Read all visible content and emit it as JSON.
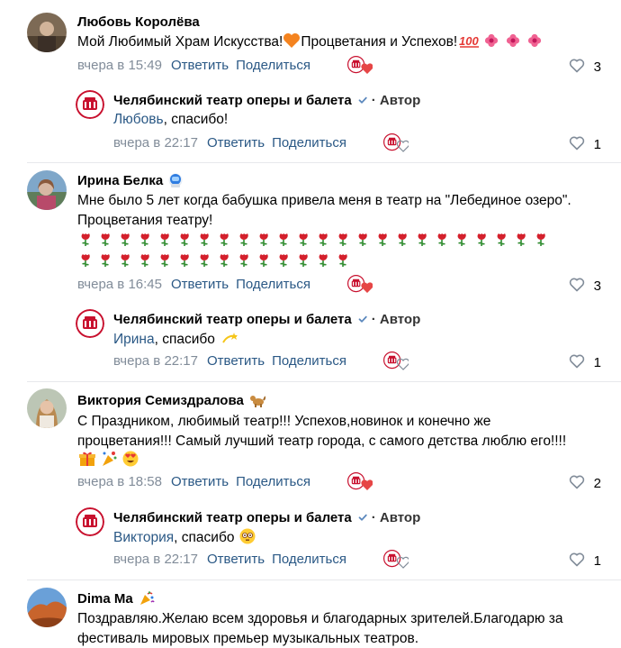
{
  "actions": {
    "reply": "Ответить",
    "share": "Поделиться"
  },
  "comments": [
    {
      "author": "Любовь Королёва",
      "text": "Мой Любимый Храм Искусства!",
      "text2": "Процветания и Успехов!",
      "time": "вчера в 15:49",
      "likes": "3",
      "reply": {
        "author": "Челябинский театр оперы и балета",
        "author_tag": "· Автор",
        "mention": "Любовь",
        "text": ", спасибо!",
        "time": "вчера в 22:17",
        "likes": "1"
      }
    },
    {
      "author": "Ирина Белка",
      "text_line1": "Мне было 5 лет когда бабушка привела меня в театр на \"Лебединое озеро\".",
      "text_line2": "Процветания театру!",
      "time": "вчера в 16:45",
      "likes": "3",
      "reply": {
        "author": "Челябинский театр оперы и балета",
        "author_tag": "· Автор",
        "mention": "Ирина",
        "text": ", спасибо",
        "time": "вчера в 22:17",
        "likes": "1"
      }
    },
    {
      "author": "Виктория Семиздралова",
      "text_line1": "С Праздником, любимый театр!!! Успехов,новинок и конечно же",
      "text_line2": "процветания!!! Самый лучший театр города, с самого детства люблю его!!!!",
      "time": "вчера в 18:58",
      "likes": "2",
      "reply": {
        "author": "Челябинский театр оперы и балета",
        "author_tag": "· Автор",
        "mention": "Виктория",
        "text": ", спасибо",
        "time": "вчера в 22:17",
        "likes": "1"
      }
    },
    {
      "author": "Dima Ma",
      "text_line1": "Поздравляю.Желаю всем здоровья и благодарных зрителей.Благодарю за",
      "text_line2": "фестиваль мировых премьер музыкальных театров."
    }
  ],
  "colors": {
    "link": "#2a5885",
    "meta": "#818c99",
    "divider": "#e7e8ec",
    "brand": "#c8102e"
  }
}
